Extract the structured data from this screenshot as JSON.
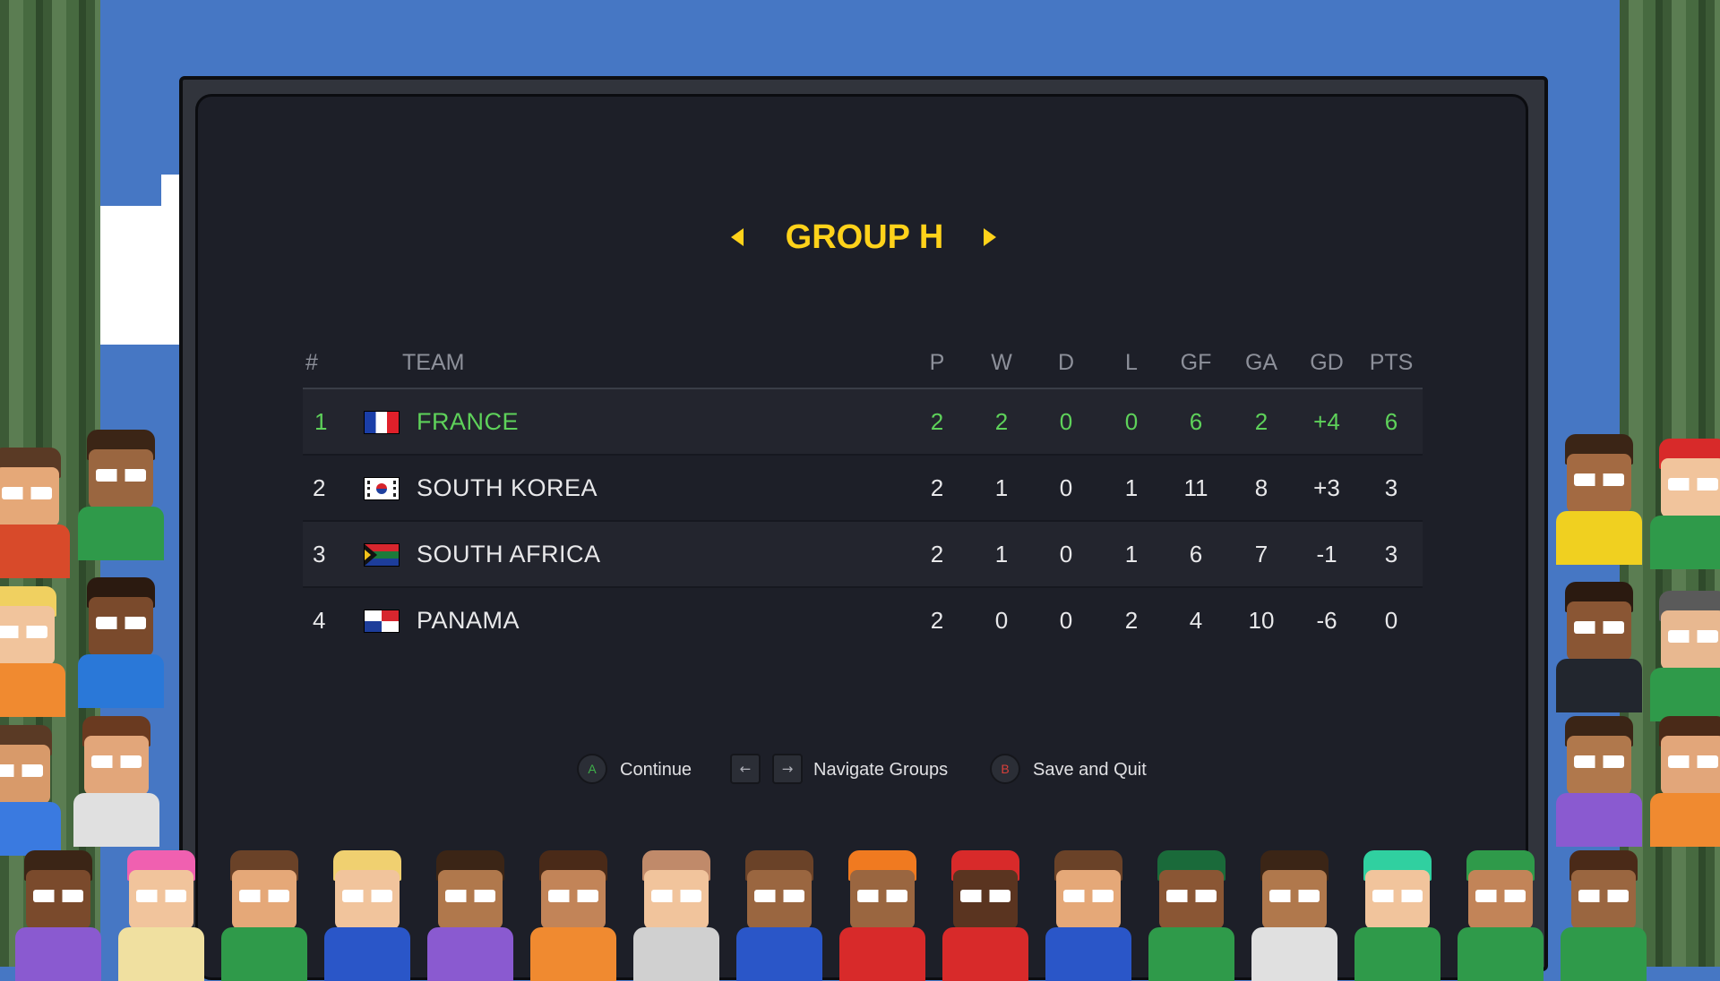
{
  "group": {
    "title": "GROUP H",
    "prev_icon": "arrow-left-icon",
    "next_icon": "arrow-right-icon"
  },
  "table": {
    "headers": [
      "#",
      "TEAM",
      "P",
      "W",
      "D",
      "L",
      "GF",
      "GA",
      "GD",
      "PTS"
    ],
    "rows": [
      {
        "pos": "1",
        "flag": "france-flag-icon",
        "team": "FRANCE",
        "p": "2",
        "w": "2",
        "d": "0",
        "l": "0",
        "gf": "6",
        "ga": "2",
        "gd": "+4",
        "pts": "6"
      },
      {
        "pos": "2",
        "flag": "south-korea-flag-icon",
        "team": "SOUTH KOREA",
        "p": "2",
        "w": "1",
        "d": "0",
        "l": "1",
        "gf": "11",
        "ga": "8",
        "gd": "+3",
        "pts": "3"
      },
      {
        "pos": "3",
        "flag": "south-africa-flag-icon",
        "team": "SOUTH AFRICA",
        "p": "2",
        "w": "1",
        "d": "0",
        "l": "1",
        "gf": "6",
        "ga": "7",
        "gd": "-1",
        "pts": "3"
      },
      {
        "pos": "4",
        "flag": "panama-flag-icon",
        "team": "PANAMA",
        "p": "2",
        "w": "0",
        "d": "0",
        "l": "2",
        "gf": "4",
        "ga": "10",
        "gd": "-6",
        "pts": "0"
      }
    ]
  },
  "controls": {
    "continue": {
      "button": "A",
      "label": "Continue"
    },
    "navigate": {
      "left_key": "←",
      "right_key": "→",
      "label": "Navigate Groups"
    },
    "quit": {
      "button": "B",
      "label": "Save and Quit"
    }
  },
  "colors": {
    "title": "#ffd21a",
    "leader": "#5ed25a",
    "board": "#1d1f28",
    "sky": "#4677c4",
    "button_a": "#3fb04a",
    "button_b": "#d8403a"
  }
}
